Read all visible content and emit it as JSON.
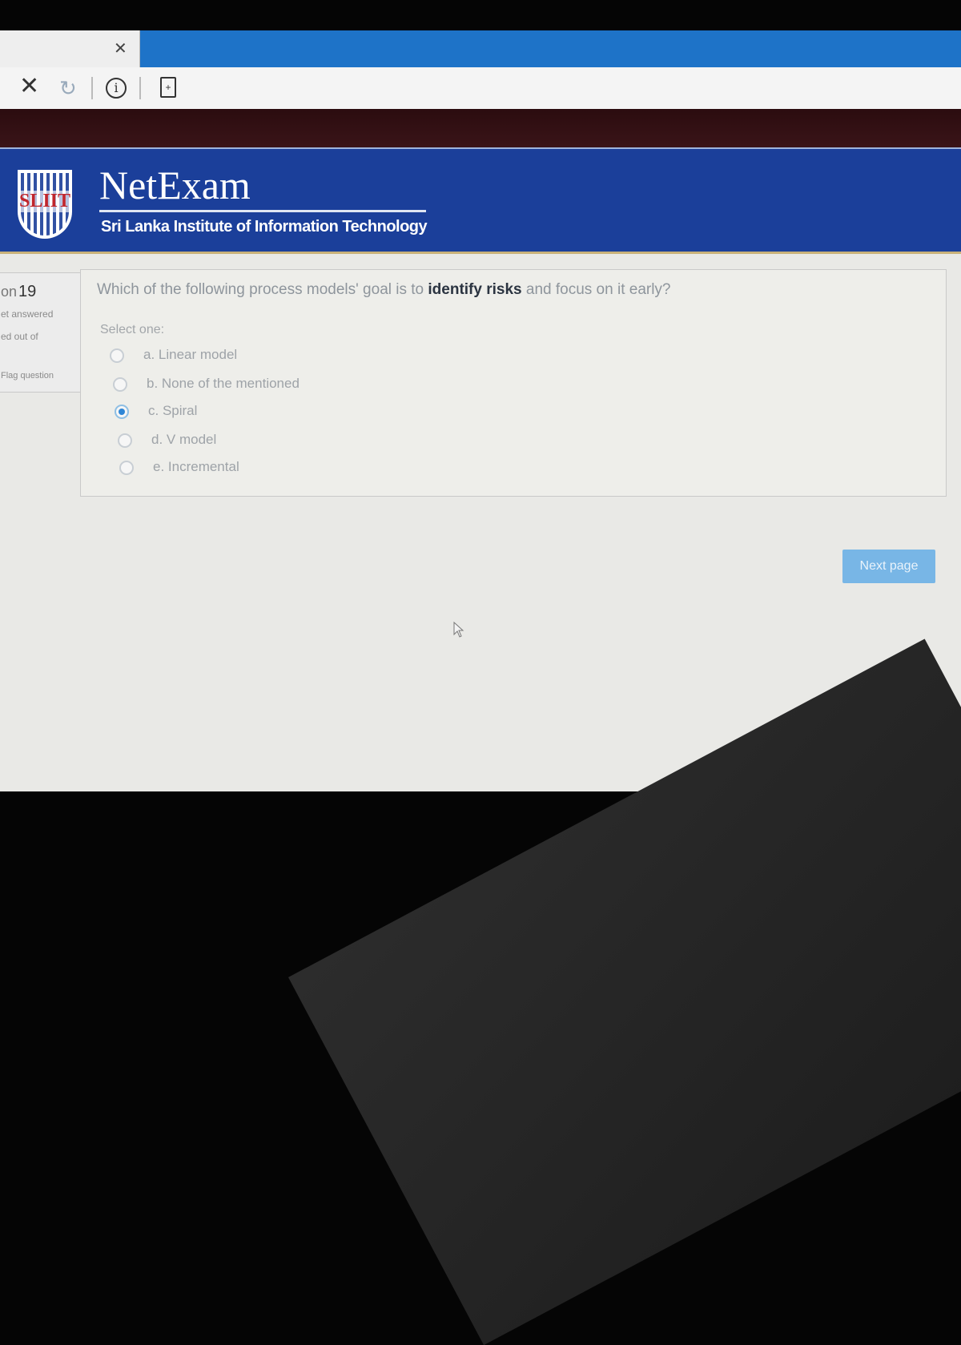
{
  "browser": {
    "tab_close_icon": "close-icon",
    "toolbar_icons": [
      "stop-icon",
      "reload-icon",
      "info-icon",
      "page-icon"
    ]
  },
  "header": {
    "brand": "NetExam",
    "subtitle": "Sri Lanka Institute of Information Technology",
    "logo_text": "SLIIT"
  },
  "nav": {
    "question_number": "19",
    "question_prefix": "on",
    "status_1": "et answered",
    "status_2": "ed out of",
    "flag": "Flag question"
  },
  "question": {
    "text_before": "Which of the following process models' goal is to ",
    "text_emphasis": "identify risks",
    "text_after": " and focus on it early?",
    "select_one": "Select one:",
    "options": [
      {
        "label": "a. Linear model",
        "selected": false
      },
      {
        "label": "b. None of the mentioned",
        "selected": false
      },
      {
        "label": "c. Spiral",
        "selected": true
      },
      {
        "label": "d. V model",
        "selected": false
      },
      {
        "label": "e. Incremental",
        "selected": false
      }
    ]
  },
  "actions": {
    "next_label": "Next page"
  },
  "colors": {
    "header_blue": "#1b3f9a",
    "tabbar_blue": "#1e73c8",
    "button_blue": "#78b6e6",
    "radio_selected": "#2f86d6"
  }
}
